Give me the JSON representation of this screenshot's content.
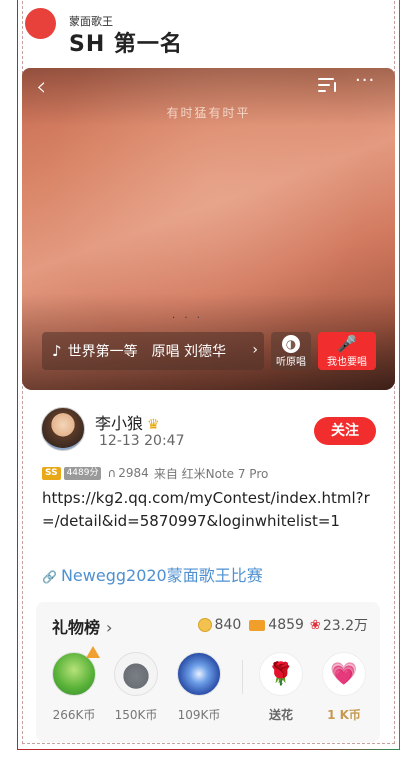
{
  "header": {
    "brand_small": "蒙面歌王",
    "brand_big": "SH 第一名"
  },
  "video": {
    "caption": "有时猛有时平",
    "song_label": "世界第一等　原唱 刘德华",
    "listen_label": "听原唱",
    "sing_label": "我也要唱"
  },
  "user": {
    "name": "李小狼",
    "time": "12-13 20:47",
    "follow_label": "关注"
  },
  "meta": {
    "badge_level": "SS",
    "badge_score": "4489分",
    "listen_count": "2984",
    "source": "来自 红米Note 7 Pro"
  },
  "post": {
    "text": "https://kg2.qq.com/myContest/index.html?r=/detail&id=5870997&loginwhitelist=1",
    "link_text": "Newegg2020蒙面歌王比赛"
  },
  "gifts": {
    "title": "礼物榜",
    "coins": "840",
    "cards": "4859",
    "flowers": "23.2万",
    "donors": [
      {
        "amount": "266K币"
      },
      {
        "amount": "150K币"
      },
      {
        "amount": "109K币"
      }
    ],
    "options": [
      {
        "label": "送花"
      },
      {
        "label": "1 K币"
      }
    ]
  },
  "colors": {
    "accent_red": "#f22d2d",
    "link_blue": "#4f90d0",
    "gold": "#c79a52"
  }
}
